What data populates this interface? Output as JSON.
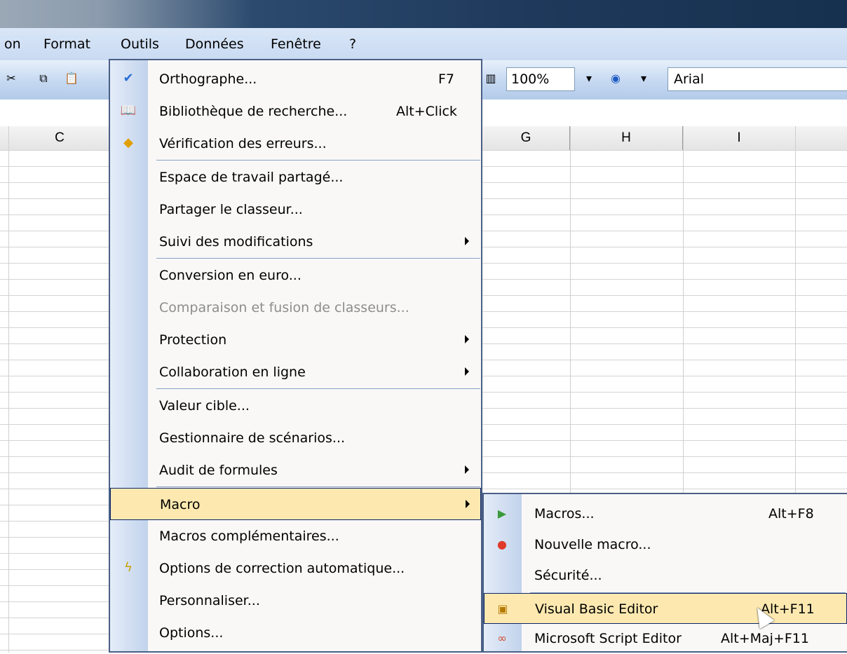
{
  "menubar": {
    "items": [
      {
        "label": "on"
      },
      {
        "label": "Format"
      },
      {
        "label": "Outils"
      },
      {
        "label": "Données"
      },
      {
        "label": "Fenêtre"
      },
      {
        "label": "?"
      }
    ]
  },
  "toolbar": {
    "zoom": "100%",
    "font": "Arial"
  },
  "columns": [
    "C",
    "G",
    "H",
    "I"
  ],
  "outils_menu": {
    "items": [
      {
        "label": "Orthographe...",
        "shortcut": "F7",
        "icon": "spell-check-icon"
      },
      {
        "label": "Bibliothèque de recherche...",
        "shortcut": "Alt+Click",
        "icon": "research-icon"
      },
      {
        "label": "Vérification des erreurs...",
        "icon": "error-check-icon"
      },
      {
        "label": "Espace de travail partagé..."
      },
      {
        "label": "Partager le classeur..."
      },
      {
        "label": "Suivi des modifications",
        "submenu": true
      },
      {
        "label": "Conversion en euro..."
      },
      {
        "label": "Comparaison et fusion de classeurs...",
        "disabled": true
      },
      {
        "label": "Protection",
        "submenu": true
      },
      {
        "label": "Collaboration en ligne",
        "submenu": true
      },
      {
        "label": "Valeur cible..."
      },
      {
        "label": "Gestionnaire de scénarios..."
      },
      {
        "label": "Audit de formules",
        "submenu": true
      },
      {
        "label": "Macro",
        "submenu": true,
        "highlighted": true
      },
      {
        "label": "Macros complémentaires..."
      },
      {
        "label": "Options de correction automatique...",
        "icon": "autocorrect-icon"
      },
      {
        "label": "Personnaliser..."
      },
      {
        "label": "Options..."
      }
    ]
  },
  "macro_submenu": {
    "items": [
      {
        "label": "Macros...",
        "shortcut": "Alt+F8",
        "icon": "run-macro-icon"
      },
      {
        "label": "Nouvelle macro...",
        "icon": "record-icon"
      },
      {
        "label": "Sécurité..."
      },
      {
        "label": "Visual Basic Editor",
        "shortcut": "Alt+F11",
        "icon": "vba-editor-icon",
        "highlighted": true
      },
      {
        "label": "Microsoft Script Editor",
        "shortcut": "Alt+Maj+F11",
        "icon": "script-editor-icon"
      }
    ]
  },
  "colors": {
    "highlight": "#fde9b0",
    "menu_border": "#4a5f86",
    "menubar": "#c9daf2"
  }
}
